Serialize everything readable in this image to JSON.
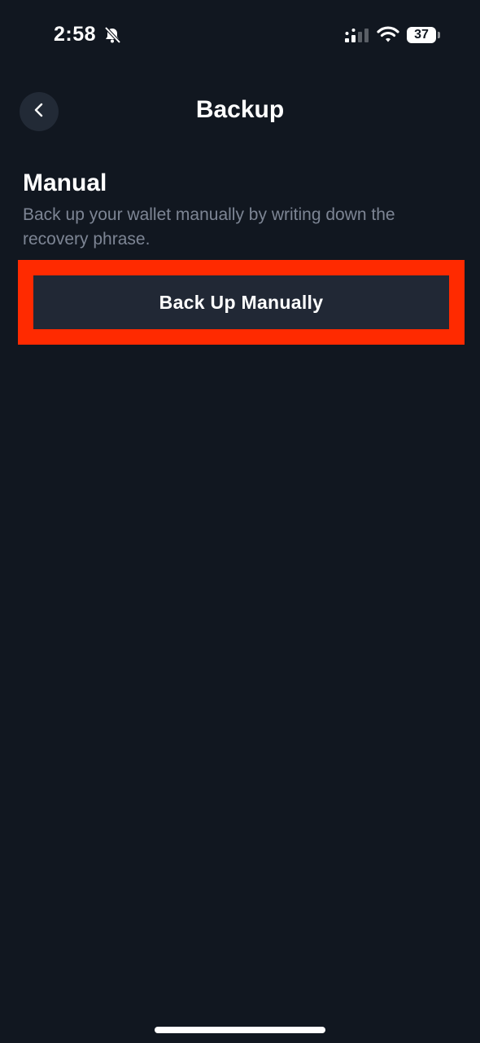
{
  "status_bar": {
    "time": "2:58",
    "battery": "37",
    "icons": [
      "bell-slash-icon",
      "signal-icon",
      "wifi-icon",
      "battery-icon"
    ]
  },
  "header": {
    "title": "Backup",
    "back_icon": "chevron-left-icon"
  },
  "manual_section": {
    "title": "Manual",
    "description": "Back up your wallet manually by writing down the recovery phrase.",
    "button_label": "Back Up Manually"
  },
  "colors": {
    "background": "#111720",
    "button": "#212835",
    "highlight": "#ff2a00",
    "muted_text": "#7d8594"
  }
}
